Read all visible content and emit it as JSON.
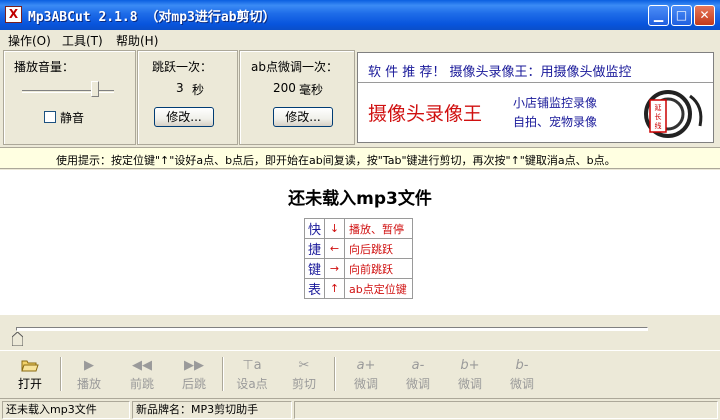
{
  "window": {
    "title": "Mp3ABCut 2.1.8 （对mp3进行ab剪切）",
    "icon_letter": "X"
  },
  "menu": [
    {
      "label": "操作(O)"
    },
    {
      "label": "工具(T)"
    },
    {
      "label": "帮助(H)"
    }
  ],
  "volume": {
    "label": "播放音量：",
    "level": 0.85,
    "mute_label": "静音",
    "muted": false
  },
  "jump": {
    "label": "跳跃一次：",
    "value": "3",
    "unit": "秒",
    "edit_label": "修改..."
  },
  "ab_adjust": {
    "label": "ab点微调一次：",
    "value": "200",
    "unit": "毫秒",
    "edit_label": "修改..."
  },
  "ad": {
    "headline": "软 件 推 荐！ 摄像头录像王：用摄像头做监控",
    "product": "摄像头录像王",
    "line1": "小店铺监控录像",
    "line2": "自拍、宠物录像",
    "badge": "延长线"
  },
  "tip": "使用提示：按定位键\"↑\"设好a点、b点后，即开始在ab间复读，按\"Tab\"键进行剪切，再次按\"↑\"键取消a点、b点。",
  "main": {
    "title": "还未载入mp3文件",
    "shortcut_title": [
      "快",
      "捷",
      "键",
      "表"
    ],
    "shortcuts": [
      {
        "key": "↓",
        "action": "播放、暂停"
      },
      {
        "key": "←",
        "action": "向后跳跃"
      },
      {
        "key": "→",
        "action": "向前跳跃"
      },
      {
        "key": "↑",
        "action": "ab点定位键"
      }
    ]
  },
  "progress": {
    "position": 0.0
  },
  "toolbar": {
    "open": {
      "label": "打开",
      "icon": "open-folder-icon"
    },
    "play": {
      "label": "播放",
      "icon": "play-icon"
    },
    "back": {
      "label": "前跳",
      "icon": "rewind-icon"
    },
    "fwd": {
      "label": "后跳",
      "icon": "fast-forward-icon"
    },
    "setab": {
      "label": "设a点",
      "icon": "pin-a-icon"
    },
    "cut": {
      "label": "剪切",
      "icon": "scissors-icon"
    },
    "a_plus": {
      "label": "微调",
      "glyph": "a+"
    },
    "a_minus": {
      "label": "微调",
      "glyph": "a-"
    },
    "b_plus": {
      "label": "微调",
      "glyph": "b+"
    },
    "b_minus": {
      "label": "微调",
      "glyph": "b-"
    }
  },
  "status": {
    "file": "还未载入mp3文件",
    "brand": "新品牌名：MP3剪切助手"
  },
  "colors": {
    "accent_red": "#d01010",
    "accent_blue": "#1a1a9a",
    "titlebar": "#0A5FE0",
    "tip_bg": "#FFFFE1"
  }
}
